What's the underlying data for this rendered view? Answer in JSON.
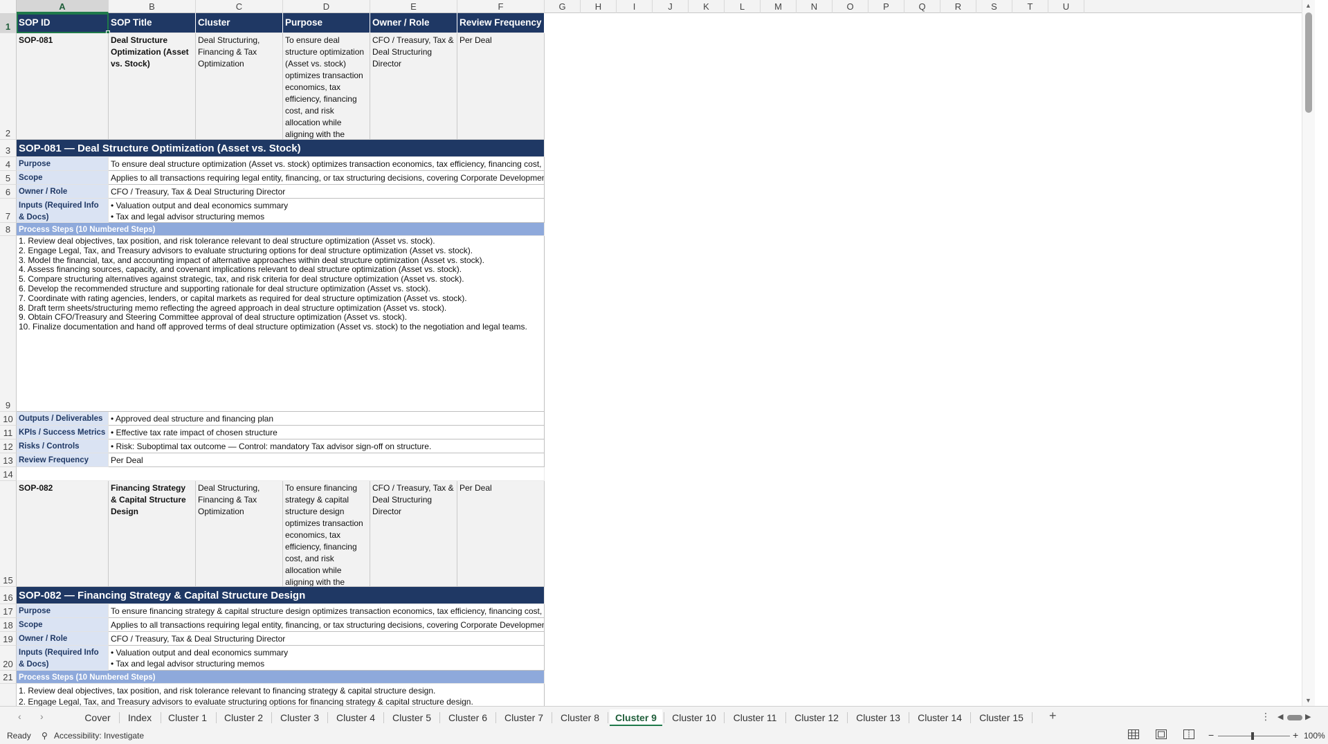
{
  "columns": [
    "A",
    "B",
    "C",
    "D",
    "E",
    "F",
    "G",
    "H",
    "I",
    "J",
    "K",
    "L",
    "M",
    "N",
    "O",
    "P",
    "Q",
    "R",
    "S",
    "T",
    "U"
  ],
  "rows": [
    "1",
    "2",
    "3",
    "4",
    "5",
    "6",
    "7",
    "8",
    "9",
    "10",
    "11",
    "12",
    "13",
    "14",
    "15",
    "16",
    "17",
    "18",
    "19",
    "20",
    "21"
  ],
  "header": [
    "SOP ID",
    "SOP Title",
    "Cluster",
    "Purpose",
    "Owner / Role",
    "Review Frequency"
  ],
  "sop1": {
    "id": "SOP-081",
    "title": "Deal Structure Optimization (Asset vs. Stock)",
    "cluster": "Deal Structuring, Financing & Tax Optimization",
    "purpose": "To ensure deal structure optimization (Asset vs. stock) optimizes transaction economics, tax efficiency, financing cost, and risk allocation while aligning with the company's overall capital strategy.",
    "owner": "CFO / Treasury, Tax & Deal Structuring Director",
    "frequency": "Per Deal",
    "band": "SOP-081  —  Deal Structure Optimization (Asset vs. Stock)",
    "labels": {
      "purpose": "Purpose",
      "scope": "Scope",
      "owner": "Owner / Role",
      "inputs": "Inputs (Required Info & Docs)",
      "process": "Process Steps (10 Numbered Steps)",
      "outputs": "Outputs / Deliverables",
      "kpis": "KPIs / Success Metrics",
      "risks": "Risks / Controls",
      "review": "Review Frequency"
    },
    "purpose_long": "To ensure deal structure optimization (Asset vs. stock) optimizes transaction economics, tax efficiency, financing cost, and risk allocation",
    "scope": "Applies to all transactions requiring legal entity, financing, or tax structuring decisions, covering Corporate Development, Treasury, Tax,",
    "owner_val": "CFO / Treasury, Tax & Deal Structuring Director",
    "inputs": [
      "• Valuation output and deal economics summary",
      "• Tax and legal advisor structuring memos"
    ],
    "steps": [
      "1. Review deal objectives, tax position, and risk tolerance relevant to deal structure optimization (Asset vs. stock).",
      "2. Engage Legal, Tax, and Treasury advisors to evaluate structuring options for deal structure optimization (Asset vs. stock).",
      "3. Model the financial, tax, and accounting impact of alternative approaches within deal structure optimization (Asset vs. stock).",
      "4. Assess financing sources, capacity, and covenant implications relevant to deal structure optimization (Asset vs. stock).",
      "5. Compare structuring alternatives against strategic, tax, and risk criteria for deal structure optimization (Asset vs. stock).",
      "6. Develop the recommended structure and supporting rationale for deal structure optimization (Asset vs. stock).",
      "7. Coordinate with rating agencies, lenders, or capital markets as required for deal structure optimization (Asset vs. stock).",
      "8. Draft term sheets/structuring memo reflecting the agreed approach in deal structure optimization (Asset vs. stock).",
      "9. Obtain CFO/Treasury and Steering Committee approval of deal structure optimization (Asset vs. stock).",
      "10. Finalize documentation and hand off approved terms of deal structure optimization (Asset vs. stock) to the negotiation and legal teams."
    ],
    "outputs": "• Approved deal structure and financing plan",
    "kpis": "• Effective tax rate impact of chosen structure",
    "risks": "• Risk: Suboptimal tax outcome — Control: mandatory Tax advisor sign-off on structure.",
    "review": "Per Deal"
  },
  "sop2": {
    "id": "SOP-082",
    "title": "Financing Strategy & Capital Structure Design",
    "cluster": "Deal Structuring, Financing & Tax Optimization",
    "purpose": "To ensure financing strategy & capital structure design optimizes transaction economics, tax efficiency, financing cost, and risk allocation while aligning with the company's overall capital strategy.",
    "owner": "CFO / Treasury, Tax & Deal Structuring Director",
    "frequency": "Per Deal",
    "band": "SOP-082  —  Financing Strategy & Capital Structure Design",
    "purpose_long": "To ensure financing strategy & capital structure design optimizes transaction economics, tax efficiency, financing cost, and risk allocation",
    "scope": "Applies to all transactions requiring legal entity, financing, or tax structuring decisions, covering Corporate Development, Treasury, Tax,",
    "owner_val": "CFO / Treasury, Tax & Deal Structuring Director",
    "inputs": [
      "• Valuation output and deal economics summary",
      "• Tax and legal advisor structuring memos"
    ],
    "steps": [
      "1. Review deal objectives, tax position, and risk tolerance relevant to financing strategy & capital structure design.",
      "2. Engage Legal, Tax, and Treasury advisors to evaluate structuring options for financing strategy & capital structure design."
    ]
  },
  "tabs": [
    "Cover",
    "Index",
    "Cluster 1",
    "Cluster 2",
    "Cluster 3",
    "Cluster 4",
    "Cluster 5",
    "Cluster 6",
    "Cluster 7",
    "Cluster 8",
    "Cluster 9",
    "Cluster 10",
    "Cluster 11",
    "Cluster 12",
    "Cluster 13",
    "Cluster 14",
    "Cluster 15"
  ],
  "active_tab": "Cluster 9",
  "status": {
    "ready": "Ready",
    "accessibility": "Accessibility: Investigate",
    "zoom": "100%"
  }
}
